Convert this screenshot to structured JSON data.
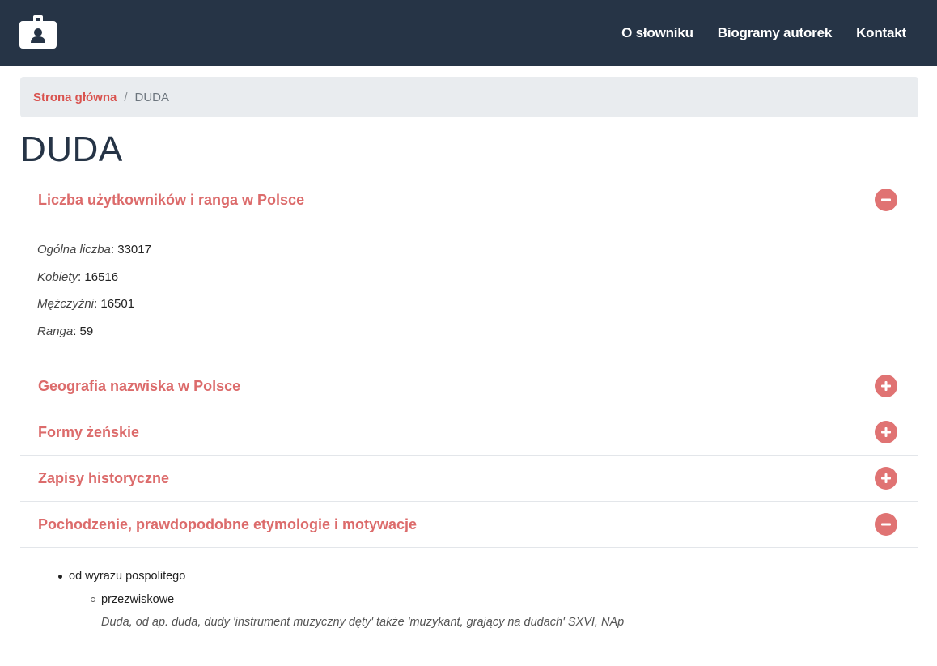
{
  "nav": {
    "links": [
      "O słowniku",
      "Biogramy autorek",
      "Kontakt"
    ]
  },
  "breadcrumb": {
    "home": "Strona główna",
    "separator": "/",
    "current": "DUDA"
  },
  "page": {
    "title": "DUDA"
  },
  "sections": [
    {
      "title": "Liczba użytkowników i ranga w Polsce",
      "expanded": true,
      "icon": "minus-circle-icon"
    },
    {
      "title": "Geografia nazwiska w Polsce",
      "expanded": false,
      "icon": "plus-circle-icon"
    },
    {
      "title": "Formy żeńskie",
      "expanded": false,
      "icon": "plus-circle-icon"
    },
    {
      "title": "Zapisy historyczne",
      "expanded": false,
      "icon": "plus-circle-icon"
    },
    {
      "title": "Pochodzenie, prawdopodobne etymologie i motywacje",
      "expanded": true,
      "icon": "minus-circle-icon"
    }
  ],
  "stats": [
    {
      "label": "Ogólna liczba",
      "value": "33017"
    },
    {
      "label": "Kobiety",
      "value": "16516"
    },
    {
      "label": "Mężczyźni",
      "value": "16501"
    },
    {
      "label": "Ranga",
      "value": "59"
    }
  ],
  "etymology": {
    "item": "od wyrazu pospolitego",
    "subitem": "przezwiskowe",
    "note": "Duda, od ap. duda, dudy 'instrument muzyczny dęty' także 'muzykant, grający na dudach' SXVI, NAp"
  },
  "colors": {
    "header_bg": "#263446",
    "accent": "#dc6b6b",
    "breadcrumb_bg": "#e9ecef"
  }
}
